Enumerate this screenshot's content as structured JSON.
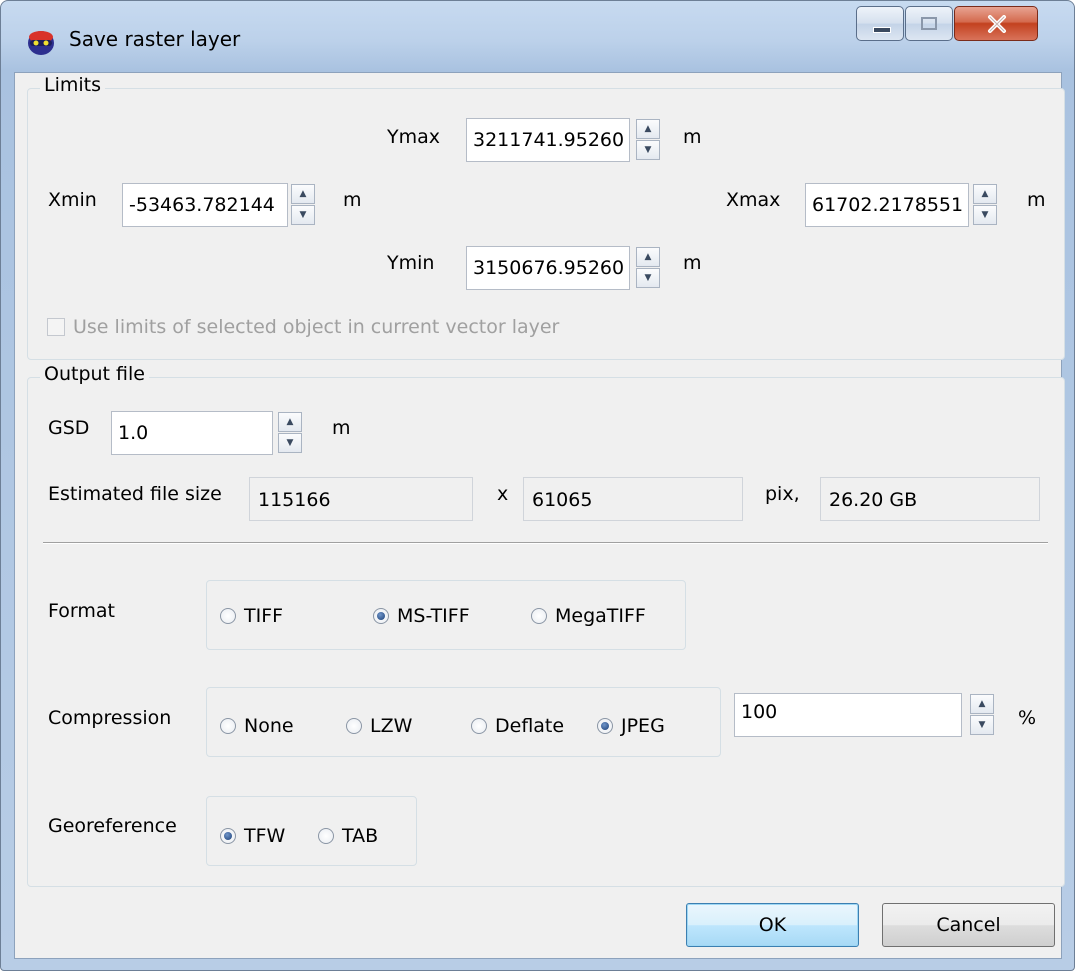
{
  "window": {
    "title": "Save raster layer"
  },
  "limits": {
    "title": "Limits",
    "ymax": {
      "label": "Ymax",
      "value": "3211741.95260",
      "unit": "m"
    },
    "xmin": {
      "label": "Xmin",
      "value": "-53463.782144",
      "unit": "m"
    },
    "xmax": {
      "label": "Xmax",
      "value": "61702.2178551",
      "unit": "m"
    },
    "ymin": {
      "label": "Ymin",
      "value": "3150676.95260",
      "unit": "m"
    },
    "use_selected_label": "Use limits of selected object in current vector layer"
  },
  "output": {
    "title": "Output file",
    "gsd": {
      "label": "GSD",
      "value": "1.0",
      "unit": "m"
    },
    "estimated": {
      "label": "Estimated file size",
      "width": "115166",
      "x": "x",
      "height": "61065",
      "pix": "pix,",
      "size": "26.20 GB"
    },
    "format": {
      "label": "Format",
      "options": [
        "TIFF",
        "MS-TIFF",
        "MegaTIFF"
      ],
      "selected": "MS-TIFF"
    },
    "compression": {
      "label": "Compression",
      "options": [
        "None",
        "LZW",
        "Deflate",
        "JPEG"
      ],
      "selected": "JPEG",
      "quality": "100",
      "unit": "%"
    },
    "georeference": {
      "label": "Georeference",
      "options": [
        "TFW",
        "TAB"
      ],
      "selected": "TFW"
    }
  },
  "buttons": {
    "ok": "OK",
    "cancel": "Cancel"
  }
}
